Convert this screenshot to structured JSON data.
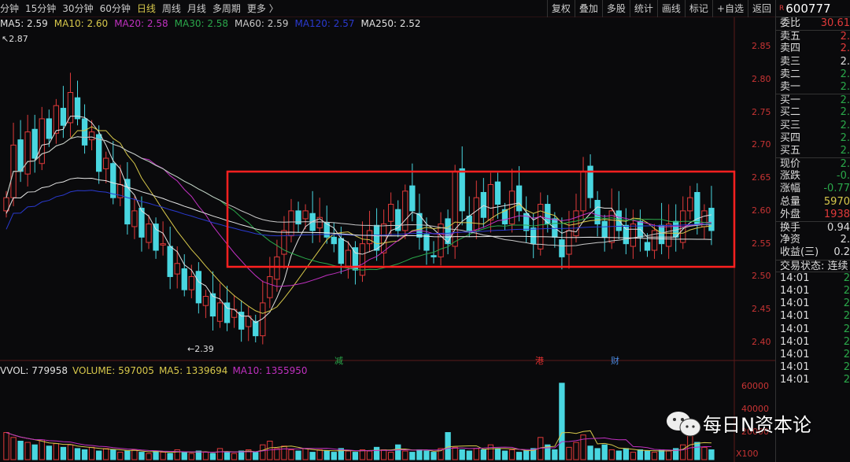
{
  "toolbar": {
    "periods": [
      "分钟",
      "15分钟",
      "30分钟",
      "60分钟",
      "日线",
      "周线",
      "月线",
      "多周期",
      "更多 〉"
    ],
    "active": "日线",
    "tools": [
      "复权",
      "叠加",
      "多股",
      "统计",
      "画线",
      "标记",
      "+自选",
      "返回"
    ]
  },
  "ma_legend": [
    {
      "t": "MA5: 2.59",
      "c": "#e0e0e0"
    },
    {
      "t": "MA10: 2.60",
      "c": "#d7c84b"
    },
    {
      "t": "MA20: 2.58",
      "c": "#c030c0"
    },
    {
      "t": "MA30: 2.58",
      "c": "#2aa84a"
    },
    {
      "t": "MA60: 2.59",
      "c": "#c8c8c8"
    },
    {
      "t": "MA120: 2.57",
      "c": "#2a3ad0"
    },
    {
      "t": "MA250: 2.52",
      "c": "#e0e0e0"
    }
  ],
  "price_axis": [
    "2.85",
    "2.80",
    "2.75",
    "2.70",
    "2.65",
    "2.60",
    "2.55",
    "2.50",
    "2.45",
    "2.40"
  ],
  "high_label": "2.87",
  "low_label": "2.39",
  "event_marks": [
    {
      "t": "减",
      "c": "#2aa84a"
    },
    {
      "t": "港",
      "c": "#e03030"
    },
    {
      "t": "财",
      "c": "#4a8ae0"
    }
  ],
  "vol_legend": [
    {
      "t": "VVOL: 779958",
      "c": "#e0e0e0"
    },
    {
      "t": "VOLUME: 597005",
      "c": "#d7c84b"
    },
    {
      "t": "MA5: 1339694",
      "c": "#d7c84b"
    },
    {
      "t": "MA10: 1355950",
      "c": "#c030c0"
    }
  ],
  "vol_axis": [
    "60000",
    "40000",
    "20000",
    "X100"
  ],
  "colors": {
    "up": "#e03a3a",
    "down": "#49d6e0",
    "box": "#ff2020"
  },
  "chart_data": {
    "type": "candlestick",
    "closes": [
      2.62,
      2.7,
      2.66,
      2.72,
      2.68,
      2.74,
      2.71,
      2.76,
      2.73,
      2.78,
      2.74,
      2.7,
      2.72,
      2.66,
      2.68,
      2.62,
      2.64,
      2.58,
      2.6,
      2.56,
      2.58,
      2.54,
      2.55,
      2.5,
      2.52,
      2.48,
      2.5,
      2.46,
      2.47,
      2.44,
      2.46,
      2.43,
      2.45,
      2.42,
      2.44,
      2.41,
      2.46,
      2.5,
      2.53,
      2.57,
      2.6,
      2.58,
      2.6,
      2.57,
      2.59,
      2.56,
      2.55,
      2.52,
      2.54,
      2.51,
      2.55,
      2.57,
      2.54,
      2.58,
      2.61,
      2.57,
      2.63,
      2.6,
      2.56,
      2.54,
      2.53,
      2.58,
      2.55,
      2.66,
      2.6,
      2.57,
      2.62,
      2.59,
      2.64,
      2.61,
      2.58,
      2.63,
      2.6,
      2.57,
      2.55,
      2.61,
      2.58,
      2.56,
      2.53,
      2.57,
      2.6,
      2.66,
      2.62,
      2.58,
      2.56,
      2.6,
      2.57,
      2.55,
      2.58,
      2.56,
      2.54,
      2.57,
      2.55,
      2.58,
      2.56,
      2.6,
      2.62,
      2.58,
      2.6,
      2.57
    ],
    "volumes": [
      22000,
      18000,
      15000,
      14000,
      12000,
      16000,
      11000,
      13000,
      10000,
      12000,
      9000,
      8000,
      10000,
      7000,
      9000,
      8000,
      6000,
      7000,
      8000,
      6000,
      5000,
      7000,
      6000,
      5000,
      8000,
      6000,
      5000,
      7000,
      6000,
      5000,
      9000,
      6000,
      5000,
      7000,
      8000,
      6000,
      12000,
      15000,
      9000,
      11000,
      8000,
      7000,
      9000,
      6000,
      8000,
      7000,
      6000,
      9000,
      7000,
      6000,
      8000,
      7000,
      10000,
      8000,
      6000,
      12000,
      7000,
      6000,
      8000,
      7000,
      6000,
      9000,
      22000,
      10000,
      8000,
      7000,
      9000,
      8000,
      12000,
      9000,
      7000,
      8000,
      6000,
      7000,
      9000,
      18000,
      12000,
      8000,
      62000,
      10000,
      14000,
      20000,
      11000,
      9000,
      12000,
      8000,
      7000,
      9000,
      6000,
      8000,
      7000,
      6000,
      8000,
      7000,
      9000,
      12000,
      24000,
      14000,
      10000,
      8000
    ],
    "ylim": [
      2.4,
      2.85
    ]
  },
  "quote": {
    "code": "600777",
    "badge": "R",
    "rows": [
      {
        "k": "委比",
        "v": "30.61",
        "c": "#e03a3a"
      }
    ],
    "ask": [
      {
        "k": "卖五",
        "v": "2.",
        "c": "#e03a3a"
      },
      {
        "k": "卖四",
        "v": "2.",
        "c": "#e03a3a"
      },
      {
        "k": "卖三",
        "v": "2.",
        "c": "#ddd"
      },
      {
        "k": "卖二",
        "v": "2.",
        "c": "#2aa84a"
      },
      {
        "k": "卖一",
        "v": "2.",
        "c": "#2aa84a"
      }
    ],
    "bid": [
      {
        "k": "买一",
        "v": "2.",
        "c": "#2aa84a"
      },
      {
        "k": "买二",
        "v": "2.",
        "c": "#2aa84a"
      },
      {
        "k": "买三",
        "v": "2.",
        "c": "#2aa84a"
      },
      {
        "k": "买四",
        "v": "2.",
        "c": "#2aa84a"
      },
      {
        "k": "买五",
        "v": "2.",
        "c": "#2aa84a"
      }
    ],
    "stats": [
      {
        "k": "现价",
        "v": "2.",
        "c": "#2aa84a"
      },
      {
        "k": "涨跌",
        "v": "-0.",
        "c": "#2aa84a"
      },
      {
        "k": "涨幅",
        "v": "-0.77",
        "c": "#2aa84a"
      },
      {
        "k": "总量",
        "v": "5970",
        "c": "#d7c84b"
      },
      {
        "k": "外盘",
        "v": "1938",
        "c": "#e03a3a"
      }
    ],
    "stats2": [
      {
        "k": "换手",
        "v": "0.94",
        "c": "#ddd"
      },
      {
        "k": "净资",
        "v": "2.",
        "c": "#ddd"
      },
      {
        "k": "收益(三)",
        "v": "0.2",
        "c": "#ddd"
      }
    ],
    "status": "交易状态: 连续",
    "ticks": [
      {
        "t": "14:01",
        "v": "2"
      },
      {
        "t": "14:01",
        "v": "2"
      },
      {
        "t": "14:01",
        "v": "2"
      },
      {
        "t": "14:01",
        "v": "2"
      },
      {
        "t": "14:01",
        "v": "2"
      },
      {
        "t": "14:01",
        "v": "2"
      },
      {
        "t": "14:01",
        "v": "2"
      },
      {
        "t": "14:01",
        "v": "2"
      },
      {
        "t": "14:01",
        "v": "2"
      }
    ]
  },
  "watermark": "每日N资本论"
}
